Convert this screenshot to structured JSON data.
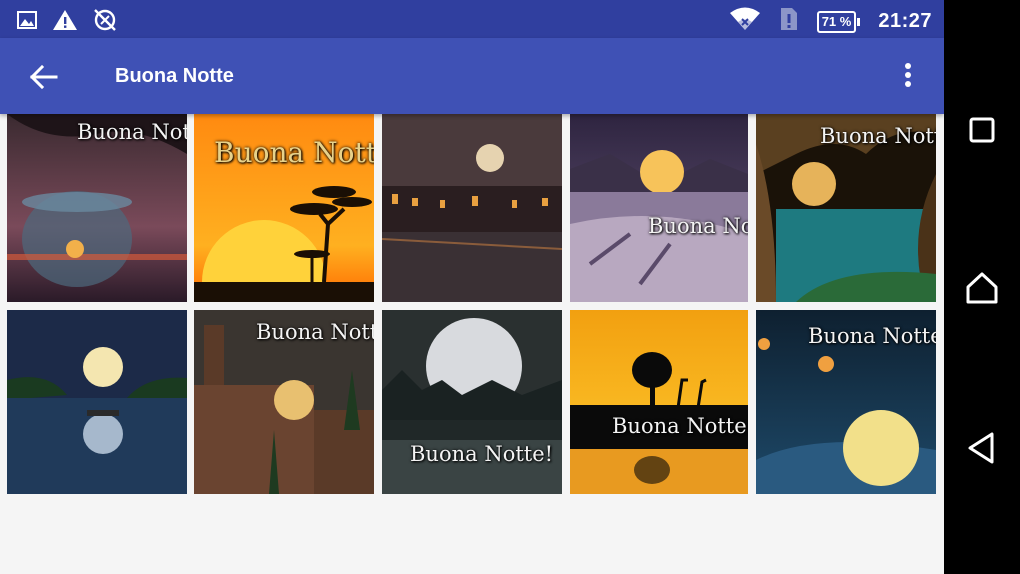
{
  "status_bar": {
    "time": "21:27",
    "battery": "71 %",
    "left_icons": [
      "image-icon",
      "warning-icon",
      "sync-disabled-icon"
    ],
    "right_icons": [
      "wifi-icon",
      "sim-card-icon",
      "battery-icon"
    ]
  },
  "app_bar": {
    "title": "Buona Notte",
    "back_icon": "arrow-back-icon",
    "menu_icon": "more-vert-icon"
  },
  "gallery": {
    "captions": [
      "Buona Notte!",
      "Buona Notte!",
      "",
      "Buona Notte!",
      "Buona Notte!",
      "",
      "Buona Notte!",
      "Buona Notte!",
      "Buona Notte!",
      "Buona Notte!"
    ]
  },
  "nav_bar": {
    "buttons": [
      "recents-icon",
      "home-icon",
      "back-icon"
    ]
  },
  "colors": {
    "status_bar": "#303f9f",
    "app_bar": "#3f51b5",
    "background": "#f5f5f5"
  }
}
